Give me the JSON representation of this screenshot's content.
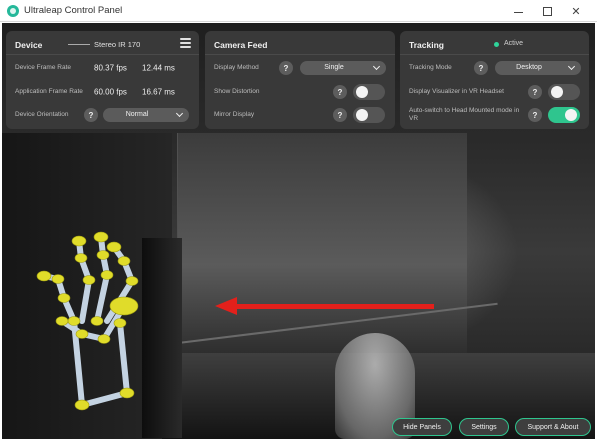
{
  "window": {
    "title": "Ultraleap Control Panel",
    "controls": [
      "minimize-icon",
      "maximize-icon",
      "close-icon"
    ]
  },
  "device_panel": {
    "title": "Device",
    "device_name": "Stereo IR 170",
    "rows": [
      {
        "label": "Device Frame Rate",
        "value": "80.37 fps",
        "value2": "12.44 ms"
      },
      {
        "label": "Application Frame Rate",
        "value": "60.00 fps",
        "value2": "16.67 ms"
      },
      {
        "label": "Device Orientation",
        "help": "?",
        "dropdown": "Normal"
      }
    ]
  },
  "camera_panel": {
    "title": "Camera Feed",
    "rows": [
      {
        "label": "Display Method",
        "help": "?",
        "dropdown": "Single"
      },
      {
        "label": "Show Distortion",
        "help": "?",
        "toggle": false
      },
      {
        "label": "Mirror Display",
        "help": "?",
        "toggle": false
      }
    ]
  },
  "tracking_panel": {
    "title": "Tracking",
    "status": "Active",
    "rows": [
      {
        "label": "Tracking Mode",
        "help": "?",
        "dropdown": "Desktop"
      },
      {
        "label": "Display Visualizer in VR Headset",
        "help": "?",
        "toggle": false
      },
      {
        "label": "Auto-switch to Head Mounted mode in VR",
        "help": "?",
        "toggle": true
      }
    ]
  },
  "bottom_buttons": [
    "Hide Panels",
    "Settings",
    "Support & About"
  ],
  "colors": {
    "accent": "#2fc58e",
    "arrow": "#e3201b",
    "panel_bg": "#3a3a3a",
    "joint": "#e0dc2a",
    "bone": "#c4d3e2"
  }
}
